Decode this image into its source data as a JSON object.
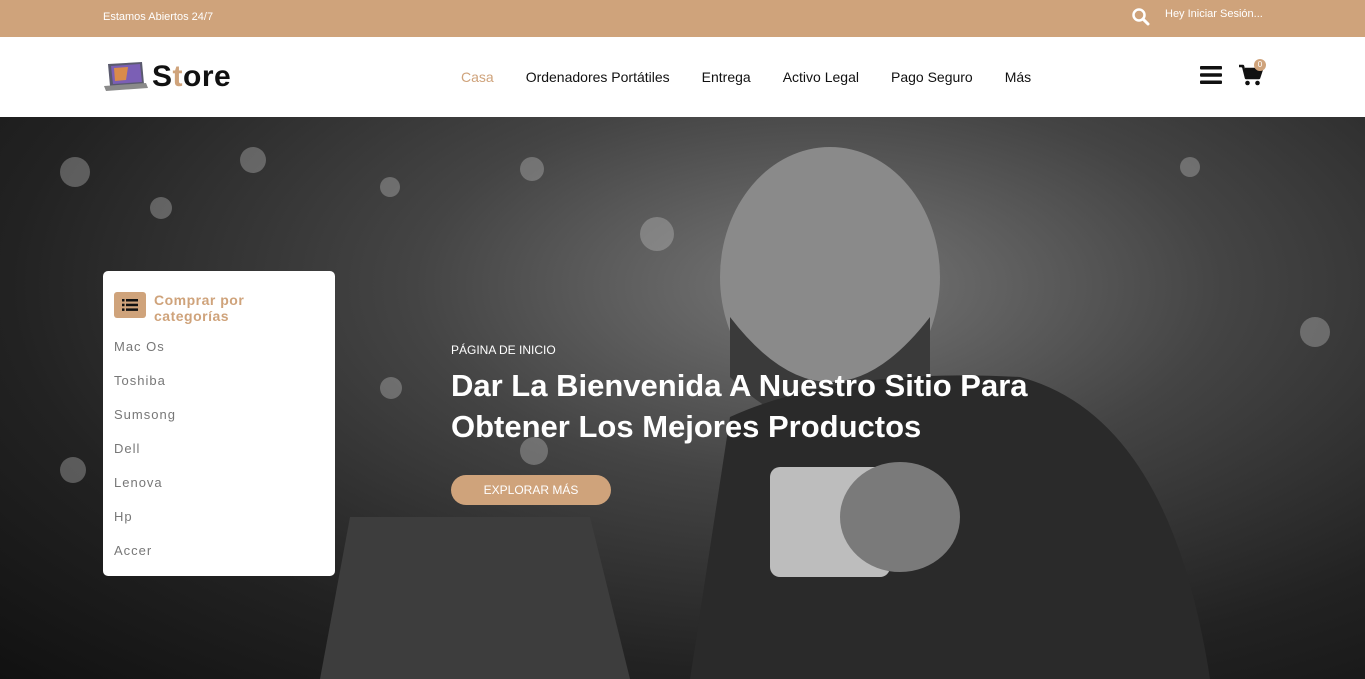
{
  "topbar": {
    "open_text": "Estamos Abiertos 24/7",
    "login": "Hey Iniciar Sesión..."
  },
  "logo": {
    "s": "S",
    "t": "t",
    "rest": "ore"
  },
  "nav": [
    "Casa",
    "Ordenadores Portátiles",
    "Entrega",
    "Activo Legal",
    "Pago Seguro",
    "Más"
  ],
  "cart": {
    "count": "0"
  },
  "categories": {
    "title": "Comprar por categorías",
    "items": [
      "Mac Os",
      "Toshiba",
      "Sumsong",
      "Dell",
      "Lenova",
      "Hp",
      "Accer"
    ]
  },
  "hero": {
    "kicker": "PÁGINA DE INICIO",
    "title": "Dar La Bienvenida A Nuestro Sitio Para Obtener Los Mejores Productos",
    "button": "EXPLORAR MÁS"
  },
  "colors": {
    "accent": "#cfa37b"
  }
}
